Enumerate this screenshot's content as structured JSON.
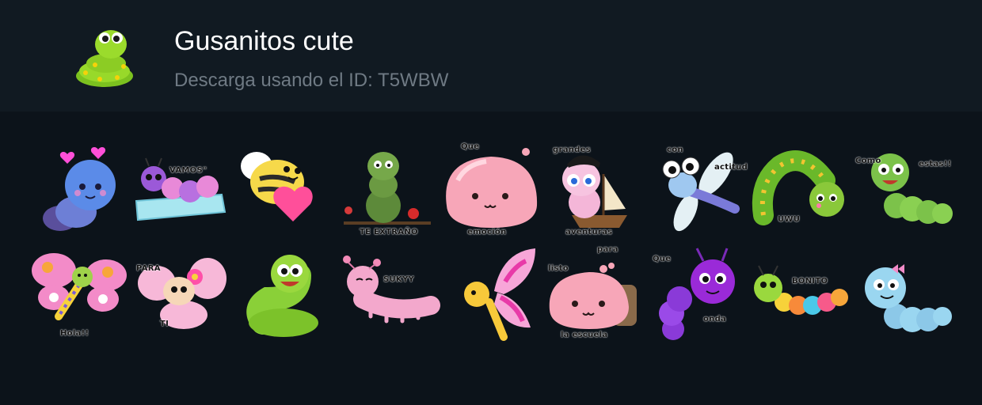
{
  "pack": {
    "title": "Gusanitos cute",
    "subtitle": "Descarga usando el ID: T5WBW",
    "icon": "green-worm-icon"
  },
  "stickers": [
    {
      "name": "blue-caterpillar-hearts",
      "captions": []
    },
    {
      "name": "pink-caterpillar-vamos",
      "captions": [
        "VAMOS\""
      ]
    },
    {
      "name": "bee-with-heart",
      "captions": []
    },
    {
      "name": "green-caterpillar-te-extrano",
      "captions": [
        "TE EXTRAÑO"
      ]
    },
    {
      "name": "pink-blob-que-emocion",
      "captions": [
        "Que",
        "emoción"
      ]
    },
    {
      "name": "pirate-worm-grandes-aventuras",
      "captions": [
        "grandes",
        "aventuras"
      ]
    },
    {
      "name": "dragonfly-con-actitud",
      "captions": [
        "con",
        "actitud"
      ]
    },
    {
      "name": "green-caterpillar-uwu",
      "captions": [
        "UWU"
      ]
    },
    {
      "name": "green-caterpillar-como-estas",
      "captions": [
        "Como",
        "estas!!"
      ]
    },
    {
      "name": "pink-butterfly-hola",
      "captions": [
        "Hola!!"
      ]
    },
    {
      "name": "butterfly-para-ti",
      "captions": [
        "PARA",
        "TI"
      ]
    },
    {
      "name": "green-worm-smiling",
      "captions": []
    },
    {
      "name": "pink-caterpillar-sukyy",
      "captions": [
        "SUKYY"
      ]
    },
    {
      "name": "yellow-butterfly-pink-wings",
      "captions": []
    },
    {
      "name": "pink-blob-listo-para-la-escuela",
      "captions": [
        "listo",
        "para",
        "la escuela"
      ]
    },
    {
      "name": "purple-caterpillar-que-onda",
      "captions": [
        "Que",
        "onda"
      ]
    },
    {
      "name": "rainbow-caterpillar-bonito",
      "captions": [
        "BONITO"
      ]
    },
    {
      "name": "blue-caterpillar-bow",
      "captions": []
    }
  ]
}
